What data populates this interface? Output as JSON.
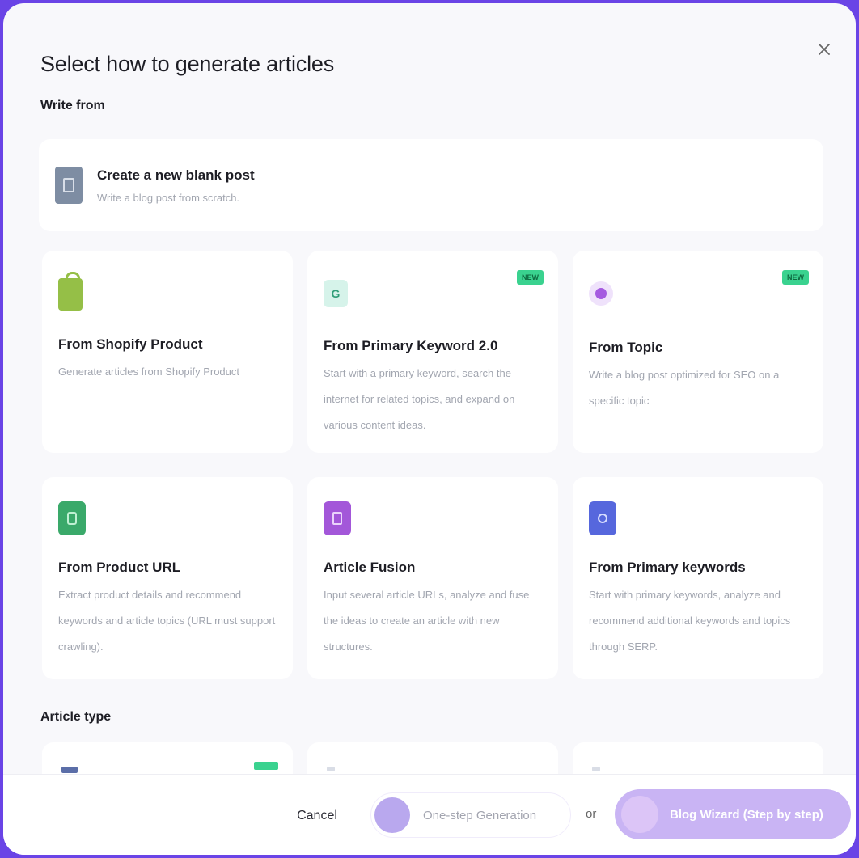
{
  "modal": {
    "title": "Select how to generate articles",
    "close_glyph": "✕"
  },
  "sections": {
    "write_from": "Write from",
    "article_type": "Article type"
  },
  "blank_post": {
    "title": "Create a new blank post",
    "description": "Write a blog post from scratch."
  },
  "cards": [
    {
      "title": "From Shopify Product",
      "description": "Generate articles from Shopify Product",
      "badge": ""
    },
    {
      "title": "From Primary Keyword 2.0",
      "description": "Start with a primary keyword, search the internet for related topics, and expand on various content ideas.",
      "badge": "NEW"
    },
    {
      "title": "From Topic",
      "description": "Write a blog post optimized for SEO on a specific topic",
      "badge": "NEW"
    },
    {
      "title": "From Product URL",
      "description": "Extract product details and recommend keywords and article topics (URL must support crawling).",
      "badge": ""
    },
    {
      "title": "Article Fusion",
      "description": "Input several article URLs, analyze and fuse the ideas to create an article with new structures.",
      "badge": ""
    },
    {
      "title": "From Primary keywords",
      "description": "Start with primary keywords, analyze and recommend additional keywords and topics through SERP.",
      "badge": ""
    }
  ],
  "footer": {
    "cancel": "Cancel",
    "one_step": "One-step Generation",
    "or": "or",
    "wizard": "Blog Wizard (Step by step)"
  },
  "colors": {
    "accent": "#6a44e6",
    "badge": "#3ad28f",
    "wizard": "#c9b4f4"
  }
}
